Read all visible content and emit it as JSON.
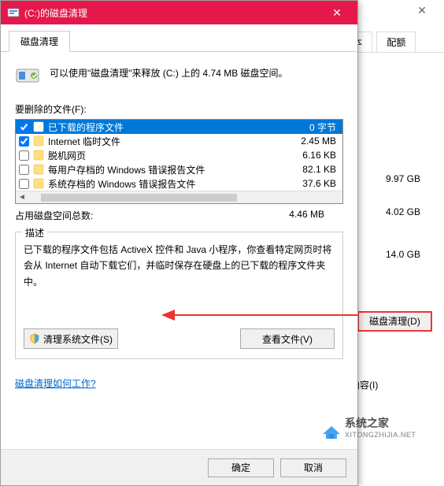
{
  "bg": {
    "tabs": [
      "版本",
      "配额"
    ],
    "rows": [
      "9.97 GB",
      "4.02 GB",
      "14.0 GB"
    ],
    "cleanup_btn": "磁盘清理(D)",
    "content_label": "内容(I)"
  },
  "dialog": {
    "title": "(C:)的磁盘清理",
    "tab": "磁盘清理",
    "intro": "可以使用\"磁盘清理\"来释放 (C:) 上的 4.74 MB 磁盘空间。",
    "files_label": "要删除的文件(F):",
    "files": [
      {
        "checked": true,
        "name": "已下载的程序文件",
        "size": "0 字节",
        "selected": true
      },
      {
        "checked": true,
        "name": "Internet 临时文件",
        "size": "2.45 MB"
      },
      {
        "checked": false,
        "name": "脱机网页",
        "size": "6.16 KB"
      },
      {
        "checked": false,
        "name": "每用户存档的 Windows 错误报告文件",
        "size": "82.1 KB"
      },
      {
        "checked": false,
        "name": "系统存档的 Windows 错误报告文件",
        "size": "37.6 KB"
      }
    ],
    "total_label": "占用磁盘空间总数:",
    "total_value": "4.46 MB",
    "desc_legend": "描述",
    "desc_text": "已下载的程序文件包括 ActiveX 控件和 Java 小程序，你查看特定网页时将会从 Internet 自动下载它们，并临时保存在硬盘上的已下载的程序文件夹中。",
    "btn_cleansys": "清理系统文件(S)",
    "btn_viewfiles": "查看文件(V)",
    "link": "磁盘清理如何工作?",
    "btn_ok": "确定",
    "btn_cancel": "取消"
  },
  "watermark": {
    "brand": "系统之家",
    "url": "XITONGZHIJIA.NET"
  }
}
